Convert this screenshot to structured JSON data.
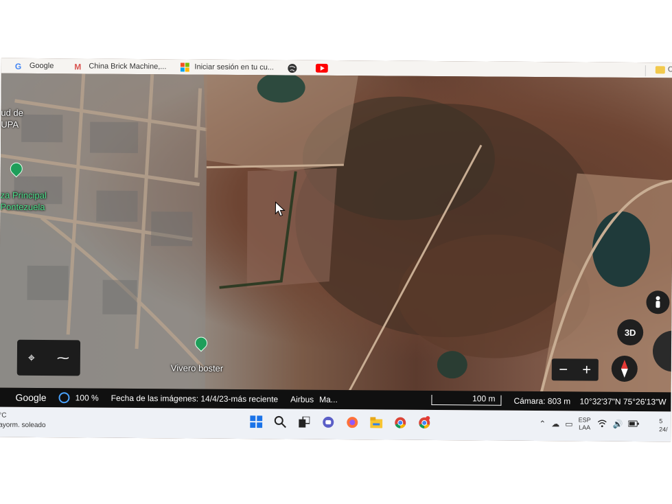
{
  "bookmarks": [
    {
      "label": "Google",
      "icon": "google-icon"
    },
    {
      "label": "China Brick Machine,...",
      "icon": "brick-machine-icon"
    },
    {
      "label": "Iniciar sesión en tu cu...",
      "icon": "microsoft-icon"
    }
  ],
  "bookmarks_more": "C",
  "map": {
    "labels": {
      "salud_line1": "ud de",
      "salud_line2": "UPA",
      "plaza_line1": "za Principal",
      "plaza_line2": "Pontezuela",
      "vivero": "Vivero boster"
    },
    "btn_3d": "3D"
  },
  "statusbar": {
    "brand": "Google",
    "load_percent": "100 %",
    "image_date": "Fecha de las imágenes: 14/4/23-más reciente",
    "provider": "Airbus",
    "provider2": "Ma...",
    "scale": "100 m",
    "camera": "Cámara: 803 m",
    "coordinates": "10°32'37\"N 75°26'13\"W"
  },
  "taskbar": {
    "weather_temp": "°C",
    "weather_text": "ayorm. soleado",
    "lang_line1": "ESP",
    "lang_line2": "LAA",
    "clock_line1": "5",
    "clock_line2": "24/"
  }
}
